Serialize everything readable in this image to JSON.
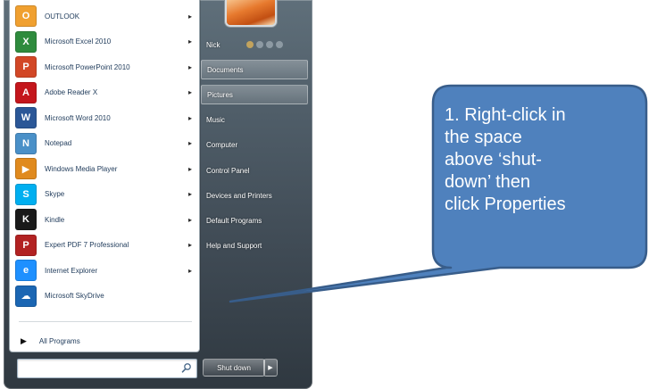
{
  "start_menu": {
    "programs": [
      {
        "label": "OUTLOOK",
        "icon": "outlook-icon",
        "glyph": "O",
        "color": "#f0a030",
        "has_arrow": true
      },
      {
        "label": "Microsoft Excel 2010",
        "icon": "excel-icon",
        "glyph": "X",
        "color": "#2e8b3d",
        "has_arrow": true
      },
      {
        "label": "Microsoft PowerPoint 2010",
        "icon": "powerpoint-icon",
        "glyph": "P",
        "color": "#d24726",
        "has_arrow": true
      },
      {
        "label": "Adobe Reader X",
        "icon": "adobe-reader-icon",
        "glyph": "A",
        "color": "#c4161c",
        "has_arrow": true
      },
      {
        "label": "Microsoft Word 2010",
        "icon": "word-icon",
        "glyph": "W",
        "color": "#2b5797",
        "has_arrow": true
      },
      {
        "label": "Notepad",
        "icon": "notepad-icon",
        "glyph": "N",
        "color": "#4a90c8",
        "has_arrow": true
      },
      {
        "label": "Windows Media Player",
        "icon": "media-player-icon",
        "glyph": "▶",
        "color": "#e08a1e",
        "has_arrow": true
      },
      {
        "label": "Skype",
        "icon": "skype-icon",
        "glyph": "S",
        "color": "#00aff0",
        "has_arrow": true
      },
      {
        "label": "Kindle",
        "icon": "kindle-icon",
        "glyph": "K",
        "color": "#1a1a1a",
        "has_arrow": true
      },
      {
        "label": "Expert PDF 7 Professional",
        "icon": "pdf-icon",
        "glyph": "P",
        "color": "#b22222",
        "has_arrow": true
      },
      {
        "label": "Internet Explorer",
        "icon": "internet-explorer-icon",
        "glyph": "e",
        "color": "#1e90ff",
        "has_arrow": true
      },
      {
        "label": "Microsoft SkyDrive",
        "icon": "skydrive-icon",
        "glyph": "☁",
        "color": "#1b66b3",
        "has_arrow": false
      }
    ],
    "all_programs_label": "All Programs",
    "search_placeholder": "",
    "right_items": [
      {
        "label": "Nick",
        "hover": false
      },
      {
        "label": "Documents",
        "hover": true
      },
      {
        "label": "Pictures",
        "hover": true
      },
      {
        "label": "Music",
        "hover": false
      },
      {
        "label": "Computer",
        "hover": false
      },
      {
        "label": "Control Panel",
        "hover": false
      },
      {
        "label": "Devices and Printers",
        "hover": false
      },
      {
        "label": "Default Programs",
        "hover": false
      },
      {
        "label": "Help and Support",
        "hover": false
      }
    ],
    "shutdown_label": "Shut down"
  },
  "callout": {
    "text": "1. Right-click in\nthe space\nabove ‘shut-\ndown’ then\nclick Properties",
    "fill": "#4f81bd",
    "stroke": "#385d8a"
  }
}
